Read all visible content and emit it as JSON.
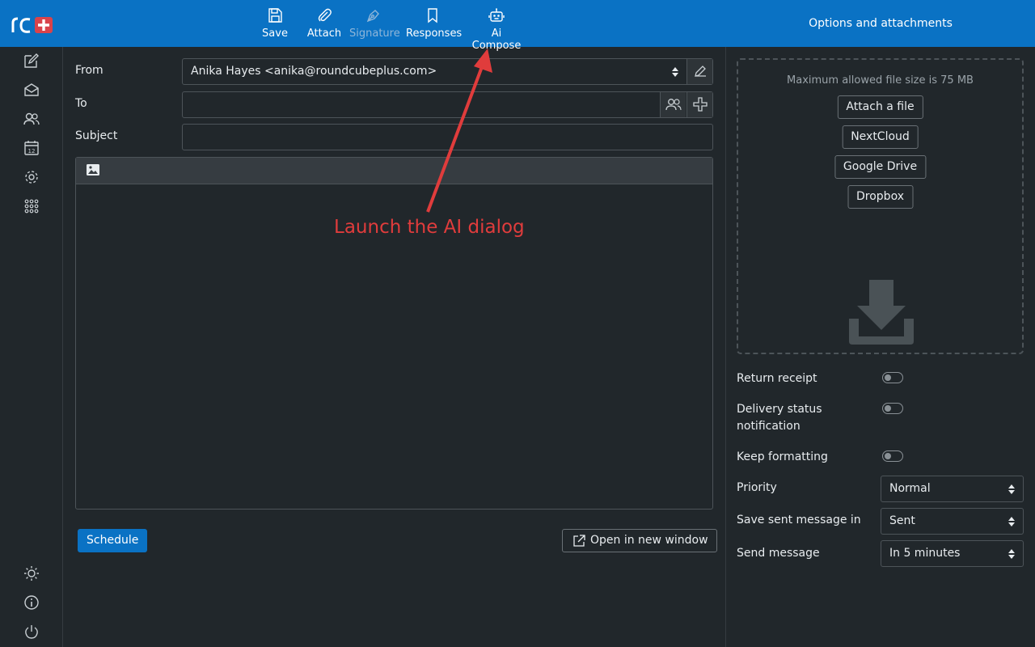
{
  "toolbar": {
    "save": "Save",
    "attach": "Attach",
    "signature": "Signature",
    "responses": "Responses",
    "ai_compose": "Ai Compose"
  },
  "right_panel_title": "Options and attachments",
  "compose": {
    "from_label": "From",
    "from_value": "Anika Hayes <anika@roundcubeplus.com>",
    "to_label": "To",
    "to_value": "",
    "subject_label": "Subject",
    "subject_value": "",
    "schedule_button": "Schedule",
    "open_new_window_button": "Open in new window"
  },
  "attachments": {
    "max_size_text": "Maximum allowed file size is 75 MB",
    "buttons": [
      "Attach a file",
      "NextCloud",
      "Google Drive",
      "Dropbox"
    ]
  },
  "options": {
    "return_receipt": "Return receipt",
    "dsn_line1": "Delivery status",
    "dsn_line2": "notification",
    "keep_formatting": "Keep formatting",
    "priority_label": "Priority",
    "priority_value": "Normal",
    "save_sent_label": "Save sent message in",
    "save_sent_value": "Sent",
    "send_message_label": "Send message",
    "send_message_value": "In 5 minutes"
  },
  "annotation": "Launch the AI dialog",
  "colors": {
    "topbar": "#0a72c4",
    "background": "#21272b",
    "annotation": "#e03c3c",
    "logo_badge": "#d9434b"
  }
}
